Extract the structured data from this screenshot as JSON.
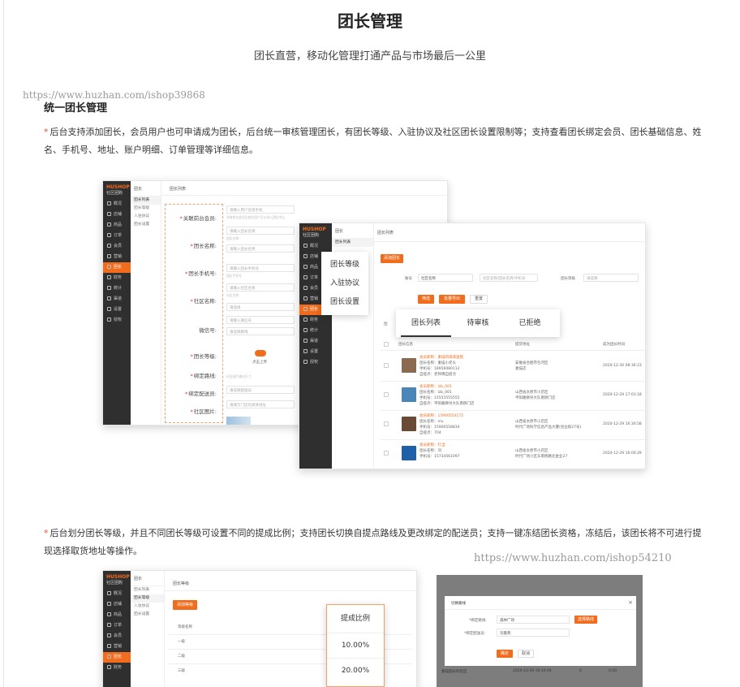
{
  "header": {
    "title": "团长管理",
    "subtitle": "团长直营，移动化管理打通产品与市场最后一公里"
  },
  "watermarks": {
    "top": "https://www.huzhan.com/ishop39868",
    "middle": "https://www.huzhan.com/ishop54210"
  },
  "section": {
    "heading": "统一团长管理",
    "para1": "后台支持添加团长，会员用户也可申请成为团长，后台统一审核管理团长，有团长等级、入驻协议及社区团长设置限制等；支持查看团长绑定会员、团长基础信息、姓名、手机号、地址、账户明细、订单管理等详细信息。",
    "para2": "后台划分团长等级，并且不同团长等级可设置不同的提成比例；支持团长切换自提点路线及更改绑定的配送员；支持一键冻结团长资格，冻结后，该团长将不可进行提现选择取货地址等操作。",
    "star": "*"
  },
  "admin": {
    "logo": "HUSHOP",
    "logo_sub": "社区团购",
    "menu": [
      "概况",
      "店铺",
      "商品",
      "订单",
      "会员",
      "营销",
      "团长",
      "财务",
      "统计",
      "渠道",
      "设置",
      "授权"
    ],
    "sub_title": "团长",
    "sub_menu": [
      "团长列表",
      "团长等级",
      "入驻协议",
      "团长设置"
    ]
  },
  "form_shot": {
    "crumb": "团长列表",
    "labels": [
      "关联前台会员:",
      "团长名称:",
      "团长手机号:",
      "社区名称:",
      "微信号:",
      "团长等级:",
      "绑定路线:",
      "绑定配送员:",
      "社区图片:"
    ],
    "required": [
      true,
      true,
      true,
      true,
      false,
      true,
      true,
      true,
      true
    ],
    "inputs": [
      "请输入用户名或手机",
      "请输入团长名称",
      "请输入团长手机号",
      "请输入社区名称",
      "请输入微信号",
      "请选择",
      "请选择路线",
      "请选择配送员",
      "请填写门店的具体地址"
    ],
    "hints": [
      "关联前台会员后前台用户可以进入团长中心",
      "团长名称",
      "团长手机号",
      "社区名称",
      "",
      "",
      "",
      "",
      "社区图片建议尺寸"
    ],
    "upload_label": "点击上传"
  },
  "list_shot": {
    "crumb": "团长列表",
    "add_button": "添加团长",
    "filter_account_label": "账号",
    "filter_account_value": "社区名称",
    "filter_search_placeholder": "社区名称/团长名称/手机号",
    "filter_level_label": "团长等级",
    "filter_level_value": "请选择",
    "btn_filter": "筛选",
    "btn_export": "批量导出",
    "btn_reset": "重置",
    "tabs": [
      "团长列表",
      "待审核",
      "已拒绝"
    ],
    "columns": [
      "团长信息",
      "提货地址",
      "成为团长时间"
    ],
    "rows": [
      {
        "nick": "会员昵称：素描的雨滴迷雨",
        "name": "团长名称：素描小老头",
        "phone": "手机号：18956080112",
        "point": "自提点：老师傅自提点",
        "addr1": "安徽省合肥市包河区",
        "addr2": "素描店",
        "time": "2020-12-30 08:36:23",
        "thumb": "#8b6a4f"
      },
      {
        "nick": "会员昵称：lzb_001",
        "name": "团长名称：lzb_001",
        "phone": "手机号：15555555555",
        "point": "自提点：平阳路教导大队南侧门店",
        "addr1": "山西省太原市小店区",
        "addr2": "平阳路教导大队南侧门店",
        "time": "2020-12-29 17:03:18",
        "thumb": "#4a87b8"
      },
      {
        "nick": "会员昵称：15900554172",
        "name": "团长名称：nlu",
        "phone": "手机号：15900558834",
        "point": "自提点：704",
        "addr1": "山西省太原市小店区",
        "addr2": "时代广场科学信息产品大厦(创业街27号)",
        "time": "2020-12-29 16:30:58",
        "thumb": "#6a4a35"
      },
      {
        "nick": "会员昵称：叮当",
        "name": "团长名称：刘",
        "phone": "手机号：15734561097",
        "point": "",
        "addr1": "山西省太原市小店区",
        "addr2": "时代广场小区东南侧路北金业27",
        "time": "2020-12-29 16:00:29",
        "thumb": "#1d5fa8"
      }
    ]
  },
  "callout_menu": [
    "团长等级",
    "入驻协议",
    "团长设置"
  ],
  "level_shot": {
    "crumb": "团长等级",
    "add_button": "添加等级",
    "column": "等级名称",
    "levels": [
      "一级",
      "二级",
      "三级"
    ]
  },
  "rate_callout": {
    "header": "提成比例",
    "values": [
      "10.00%",
      "20.00%"
    ]
  },
  "switch_modal": {
    "title": "切换路线",
    "close": "×",
    "label_route": "*绑定路线:",
    "route_value": "森林广场",
    "switch_button": "选择路线",
    "label_courier": "*绑定配送员:",
    "courier_value": "刘嘉燕",
    "ok": "确定",
    "cancel": "取消",
    "bottom_left": "素描团长的社区",
    "bottom_time": "2020-12-29 16:10:44",
    "bottom_num": "0",
    "bottom_amount": "0.00"
  },
  "colors": {
    "accent": "#f16c1c",
    "sidebar": "#2f2f2f",
    "required": "#e24"
  }
}
